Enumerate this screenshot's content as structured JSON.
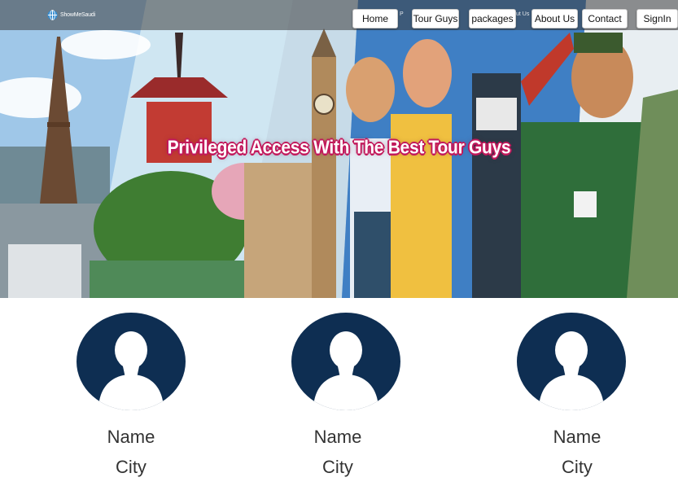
{
  "brand": {
    "logo_text": "ShowMeSaudi"
  },
  "nav": {
    "items": [
      {
        "label": "Home"
      },
      {
        "label": "Tour Guys"
      },
      {
        "label": "packages"
      },
      {
        "label": "About Us"
      },
      {
        "label": "Contact"
      },
      {
        "label": "SignIn"
      }
    ],
    "hidden_fragments": [
      "P",
      "ut Us"
    ]
  },
  "hero": {
    "title": "Privileged Access With The Best Tour Guys"
  },
  "guides": [
    {
      "name": "Name",
      "city": "City"
    },
    {
      "name": "Name",
      "city": "City"
    },
    {
      "name": "Name",
      "city": "City"
    }
  ],
  "colors": {
    "avatar_bg": "#0e2e52",
    "title_outline": "#c2185b",
    "nav_button_bg": "#ffffff"
  }
}
